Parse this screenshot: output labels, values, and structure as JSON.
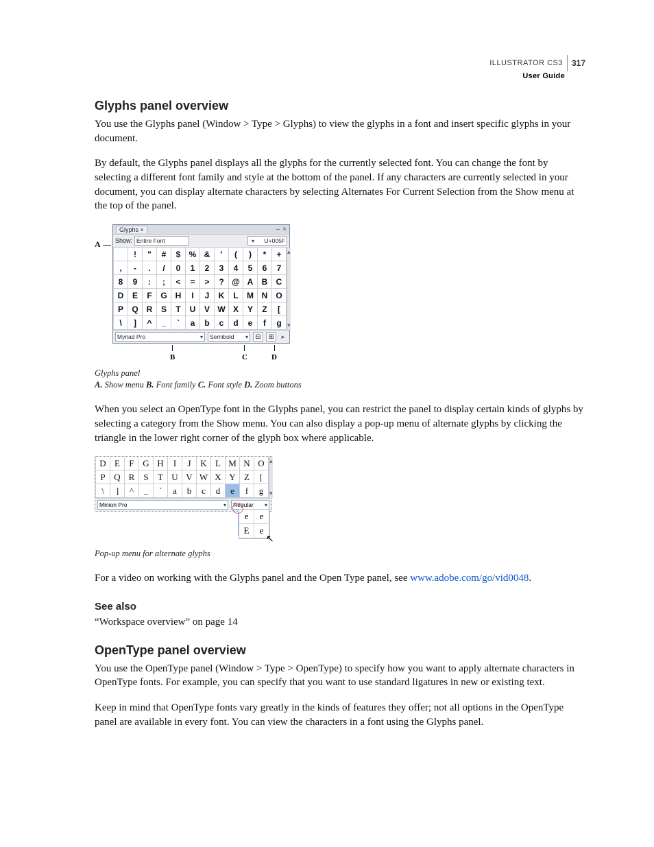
{
  "header": {
    "product": "ILLUSTRATOR CS3",
    "page_num": "317",
    "doc_title": "User Guide"
  },
  "s1": {
    "title": "Glyphs panel overview",
    "p1": "You use the Glyphs panel (Window > Type > Glyphs) to view the glyphs in a font and insert specific glyphs in your document.",
    "p2": "By default, the Glyphs panel displays all the glyphs for the currently selected font. You can change the font by selecting a different font family and style at the bottom of the panel. If any characters are currently selected in your document, you can display alternate characters by selecting Alternates For Current Selection from the Show menu at the top of the panel."
  },
  "fig1": {
    "leader_A": "A",
    "panel_tab": "Glyphs ×",
    "show_label": "Show:",
    "show_value": "Entire Font",
    "unicode": "U+005F",
    "font_family": "Myriad Pro",
    "font_style": "Semibold",
    "rows": [
      [
        "",
        "!",
        "\"",
        "#",
        "$",
        "%",
        "&",
        "'",
        "(",
        ")",
        "*",
        "+"
      ],
      [
        ",",
        "-",
        ".",
        "/",
        "0",
        "1",
        "2",
        "3",
        "4",
        "5",
        "6",
        "7"
      ],
      [
        "8",
        "9",
        ":",
        ";",
        "<",
        "=",
        ">",
        "?",
        "@",
        "A",
        "B",
        "C"
      ],
      [
        "D",
        "E",
        "F",
        "G",
        "H",
        "I",
        "J",
        "K",
        "L",
        "M",
        "N",
        "O"
      ],
      [
        "P",
        "Q",
        "R",
        "S",
        "T",
        "U",
        "V",
        "W",
        "X",
        "Y",
        "Z",
        "["
      ],
      [
        "\\",
        "]",
        "^",
        "_",
        "`",
        "a",
        "b",
        "c",
        "d",
        "e",
        "f",
        "g"
      ]
    ],
    "caption": "Glyphs panel",
    "key_A": "A.",
    "key_A_t": " Show menu  ",
    "key_B": "B.",
    "key_B_t": " Font family  ",
    "key_C": "C.",
    "key_C_t": " Font style  ",
    "key_D": "D.",
    "key_D_t": " Zoom buttons",
    "call_B": "B",
    "call_C": "C",
    "call_D": "D",
    "zoom_out": "⊟",
    "zoom_in": "⊞"
  },
  "s2": {
    "p1": "When you select an OpenType font in the Glyphs panel, you can restrict the panel to display certain kinds of glyphs by selecting a category from the Show menu. You can also display a pop-up menu of alternate glyphs by clicking the triangle in the lower right corner of the glyph box where applicable."
  },
  "fig2": {
    "rows": [
      [
        "D",
        "E",
        "F",
        "G",
        "H",
        "I",
        "J",
        "K",
        "L",
        "M",
        "N",
        "O"
      ],
      [
        "P",
        "Q",
        "R",
        "S",
        "T",
        "U",
        "V",
        "W",
        "X",
        "Y",
        "Z",
        "["
      ],
      [
        "\\",
        "]",
        "^",
        "_",
        "`",
        "a",
        "b",
        "c",
        "d",
        "e",
        "f",
        "g"
      ]
    ],
    "sel_row": 2,
    "sel_col": 9,
    "font_family": "Minion Pro",
    "font_style": "Regular",
    "alts": [
      [
        "e",
        "e"
      ],
      [
        "E",
        "e"
      ]
    ],
    "caption": "Pop-up menu for alternate glyphs"
  },
  "video": {
    "pre": "For a video on working with the Glyphs panel and the Open Type panel, see ",
    "link_text": "www.adobe.com/go/vid0048",
    "post": "."
  },
  "seealso": {
    "title": "See also",
    "item1": "“Workspace overview” on page 14"
  },
  "s3": {
    "title": "OpenType panel overview",
    "p1": "You use the OpenType panel (Window > Type > OpenType) to specify how you want to apply alternate characters in OpenType fonts. For example, you can specify that you want to use standard ligatures in new or existing text.",
    "p2": "Keep in mind that OpenType fonts vary greatly in the kinds of features they offer; not all options in the OpenType panel are available in every font. You can view the characters in a font using the Glyphs panel."
  }
}
